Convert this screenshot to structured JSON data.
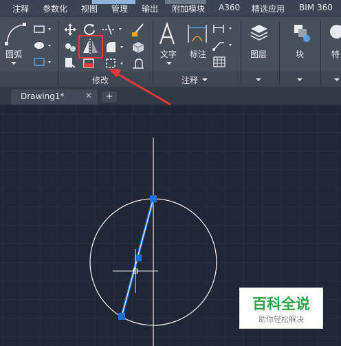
{
  "menu": {
    "items": [
      "注释",
      "参数化",
      "视图",
      "管理",
      "输出",
      "附加模块",
      "A360",
      "精选应用",
      "BIM 360"
    ]
  },
  "ribbon": {
    "draw": {
      "arc_label": "圆弧"
    },
    "modify": {
      "group_label": "修改",
      "highlighted_tool": "mirror"
    },
    "annotation": {
      "text_label": "文字",
      "dimension_label": "标注",
      "group_label": "注释"
    },
    "layers": {
      "label": "图层"
    },
    "block": {
      "label": "块"
    },
    "properties": {
      "label": "特"
    }
  },
  "document_tabs": [
    {
      "name": "Drawing1*",
      "close": "✕"
    }
  ],
  "new_tab_label": "+",
  "watermark": {
    "title": "百科全说",
    "subtitle": "助你轻松解决"
  },
  "colors": {
    "canvas": "#1f2736",
    "selection_grip": "#1e6fd9",
    "highlight_box": "#e8373a",
    "arrow": "#e8373a",
    "circle": "#e8e8e8",
    "accent_green": "#2aa547"
  }
}
